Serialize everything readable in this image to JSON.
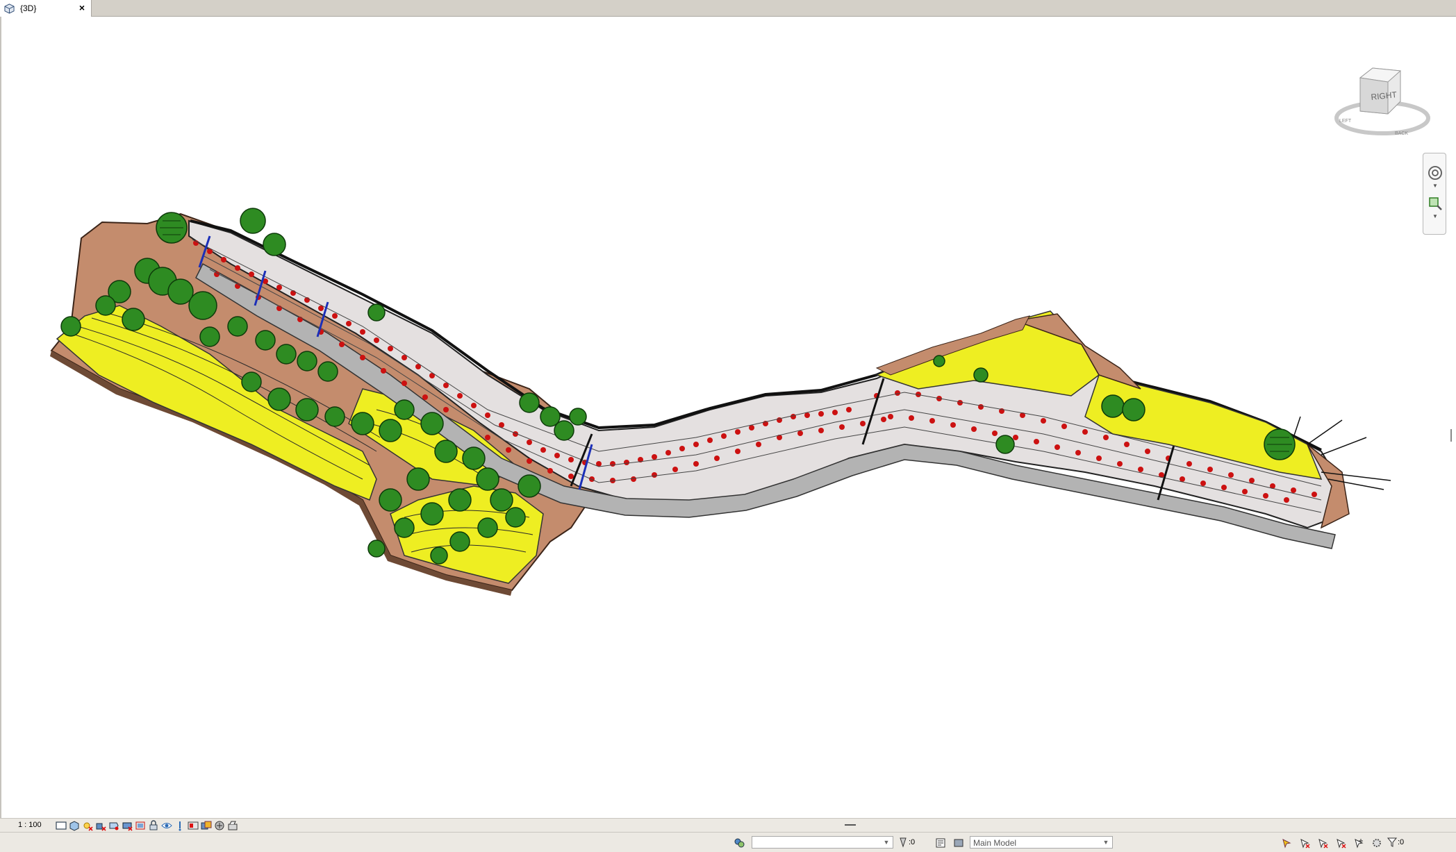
{
  "tab": {
    "label": "{3D}",
    "icon": "3d-view-icon",
    "close_icon": "close-icon"
  },
  "viewcube": {
    "face_label": "RIGHT",
    "ring_left": "LEFT",
    "ring_bottom": "BACK"
  },
  "view_control_bar": {
    "scale": "1 : 100"
  },
  "status_bar": {
    "workset_value": "",
    "editable_count": ":0",
    "model_value": "Main Model",
    "filter_count": ":0"
  },
  "colors": {
    "terrain": "#c48c6d",
    "grass": "#eeee22",
    "tree": "#2e8b22",
    "slope": "#d9d9d9",
    "red_marker": "#cc1111",
    "channel": "#b3b3b3"
  }
}
